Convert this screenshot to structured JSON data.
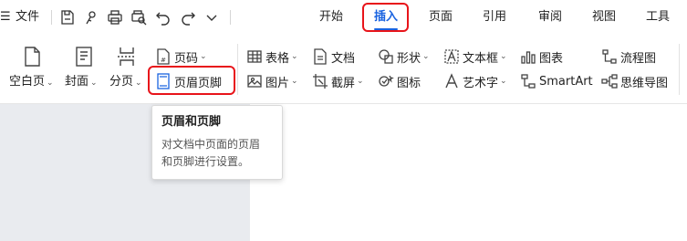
{
  "titlebar": {
    "menu_label": "文件",
    "tabs": [
      "开始",
      "插入",
      "页面",
      "引用",
      "审阅",
      "视图",
      "工具"
    ],
    "active_tab": "插入"
  },
  "ribbon": {
    "blank_page": "空白页",
    "cover": "封面",
    "page_break": "分页",
    "page_number": "页码",
    "header_footer": "页眉页脚",
    "table": "表格",
    "picture": "图片",
    "document": "文档",
    "screenshot": "截屏",
    "shape": "形状",
    "icon_lib": "图标",
    "textbox": "文本框",
    "wordart": "艺术字",
    "chart": "图表",
    "smartart": "SmartArt",
    "flowchart": "流程图",
    "mindmap": "思维导图",
    "caret": "⌄"
  },
  "tooltip": {
    "title": "页眉和页脚",
    "line1": "对文档中页面的页眉",
    "line2": "和页脚进行设置。"
  },
  "colors": {
    "accent": "#1a63e0",
    "highlight": "#e8141a"
  }
}
